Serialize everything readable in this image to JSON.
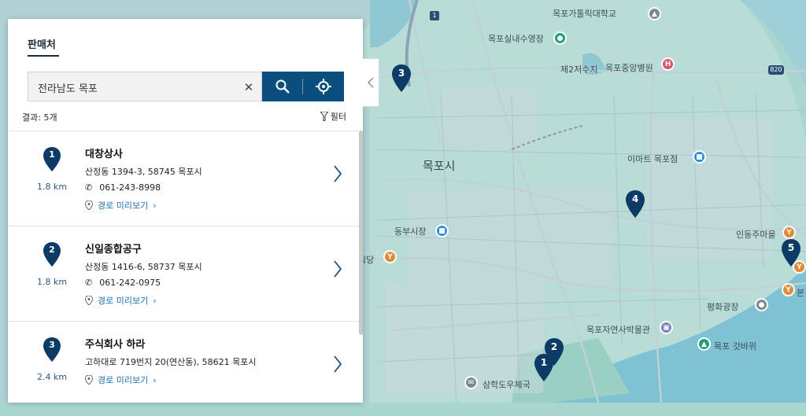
{
  "panel": {
    "tab_label": "판매처",
    "search": {
      "value": "전라남도 목포",
      "placeholder": ""
    },
    "results_label": "결과: 5개",
    "filter_label": "필터",
    "icons": {
      "search": "search-icon",
      "locate": "crosshair-icon",
      "clear": "close-icon",
      "filter": "filter-icon",
      "phone": "phone-icon",
      "route": "location-pin-icon",
      "chevron": "chevron-right-icon",
      "collapse": "chevron-left-icon"
    },
    "accent_color": "#0a4e7e",
    "items": [
      {
        "num": "1",
        "name": "대창상사",
        "address": "산정동 1394-3, 58745 목포시",
        "phone": "061-243-8998",
        "distance": "1.8 km",
        "route_label": "경로 미리보기"
      },
      {
        "num": "2",
        "name": "신일종합공구",
        "address": "산정동 1416-6, 58737 목포시",
        "phone": "061-242-0975",
        "distance": "1.8 km",
        "route_label": "경로 미리보기"
      },
      {
        "num": "3",
        "name": "주식회사 하라",
        "address": "고하대로 719번지 20(연산동), 58621 목포시",
        "phone": "",
        "distance": "2.4 km",
        "route_label": "경로 미리보기"
      }
    ]
  },
  "map": {
    "labels": {
      "city": "목포시",
      "univ": "목포가톨릭대학교",
      "pool": "목포실내수영장",
      "hospital": "목포중앙병원",
      "reservoir": "제2저수지",
      "emart": "이마트 목포점",
      "market": "동부시장",
      "sikdang": "식당",
      "museum": "목포자연사박물관",
      "post": "삼학도우체국",
      "plaza": "평화광장",
      "gatbawi": "목포 갓바위",
      "indong": "인동주마을",
      "bon": "본",
      "route_badge": "820",
      "road_num": "1"
    },
    "pins": [
      "1",
      "2",
      "3",
      "4",
      "5"
    ]
  }
}
